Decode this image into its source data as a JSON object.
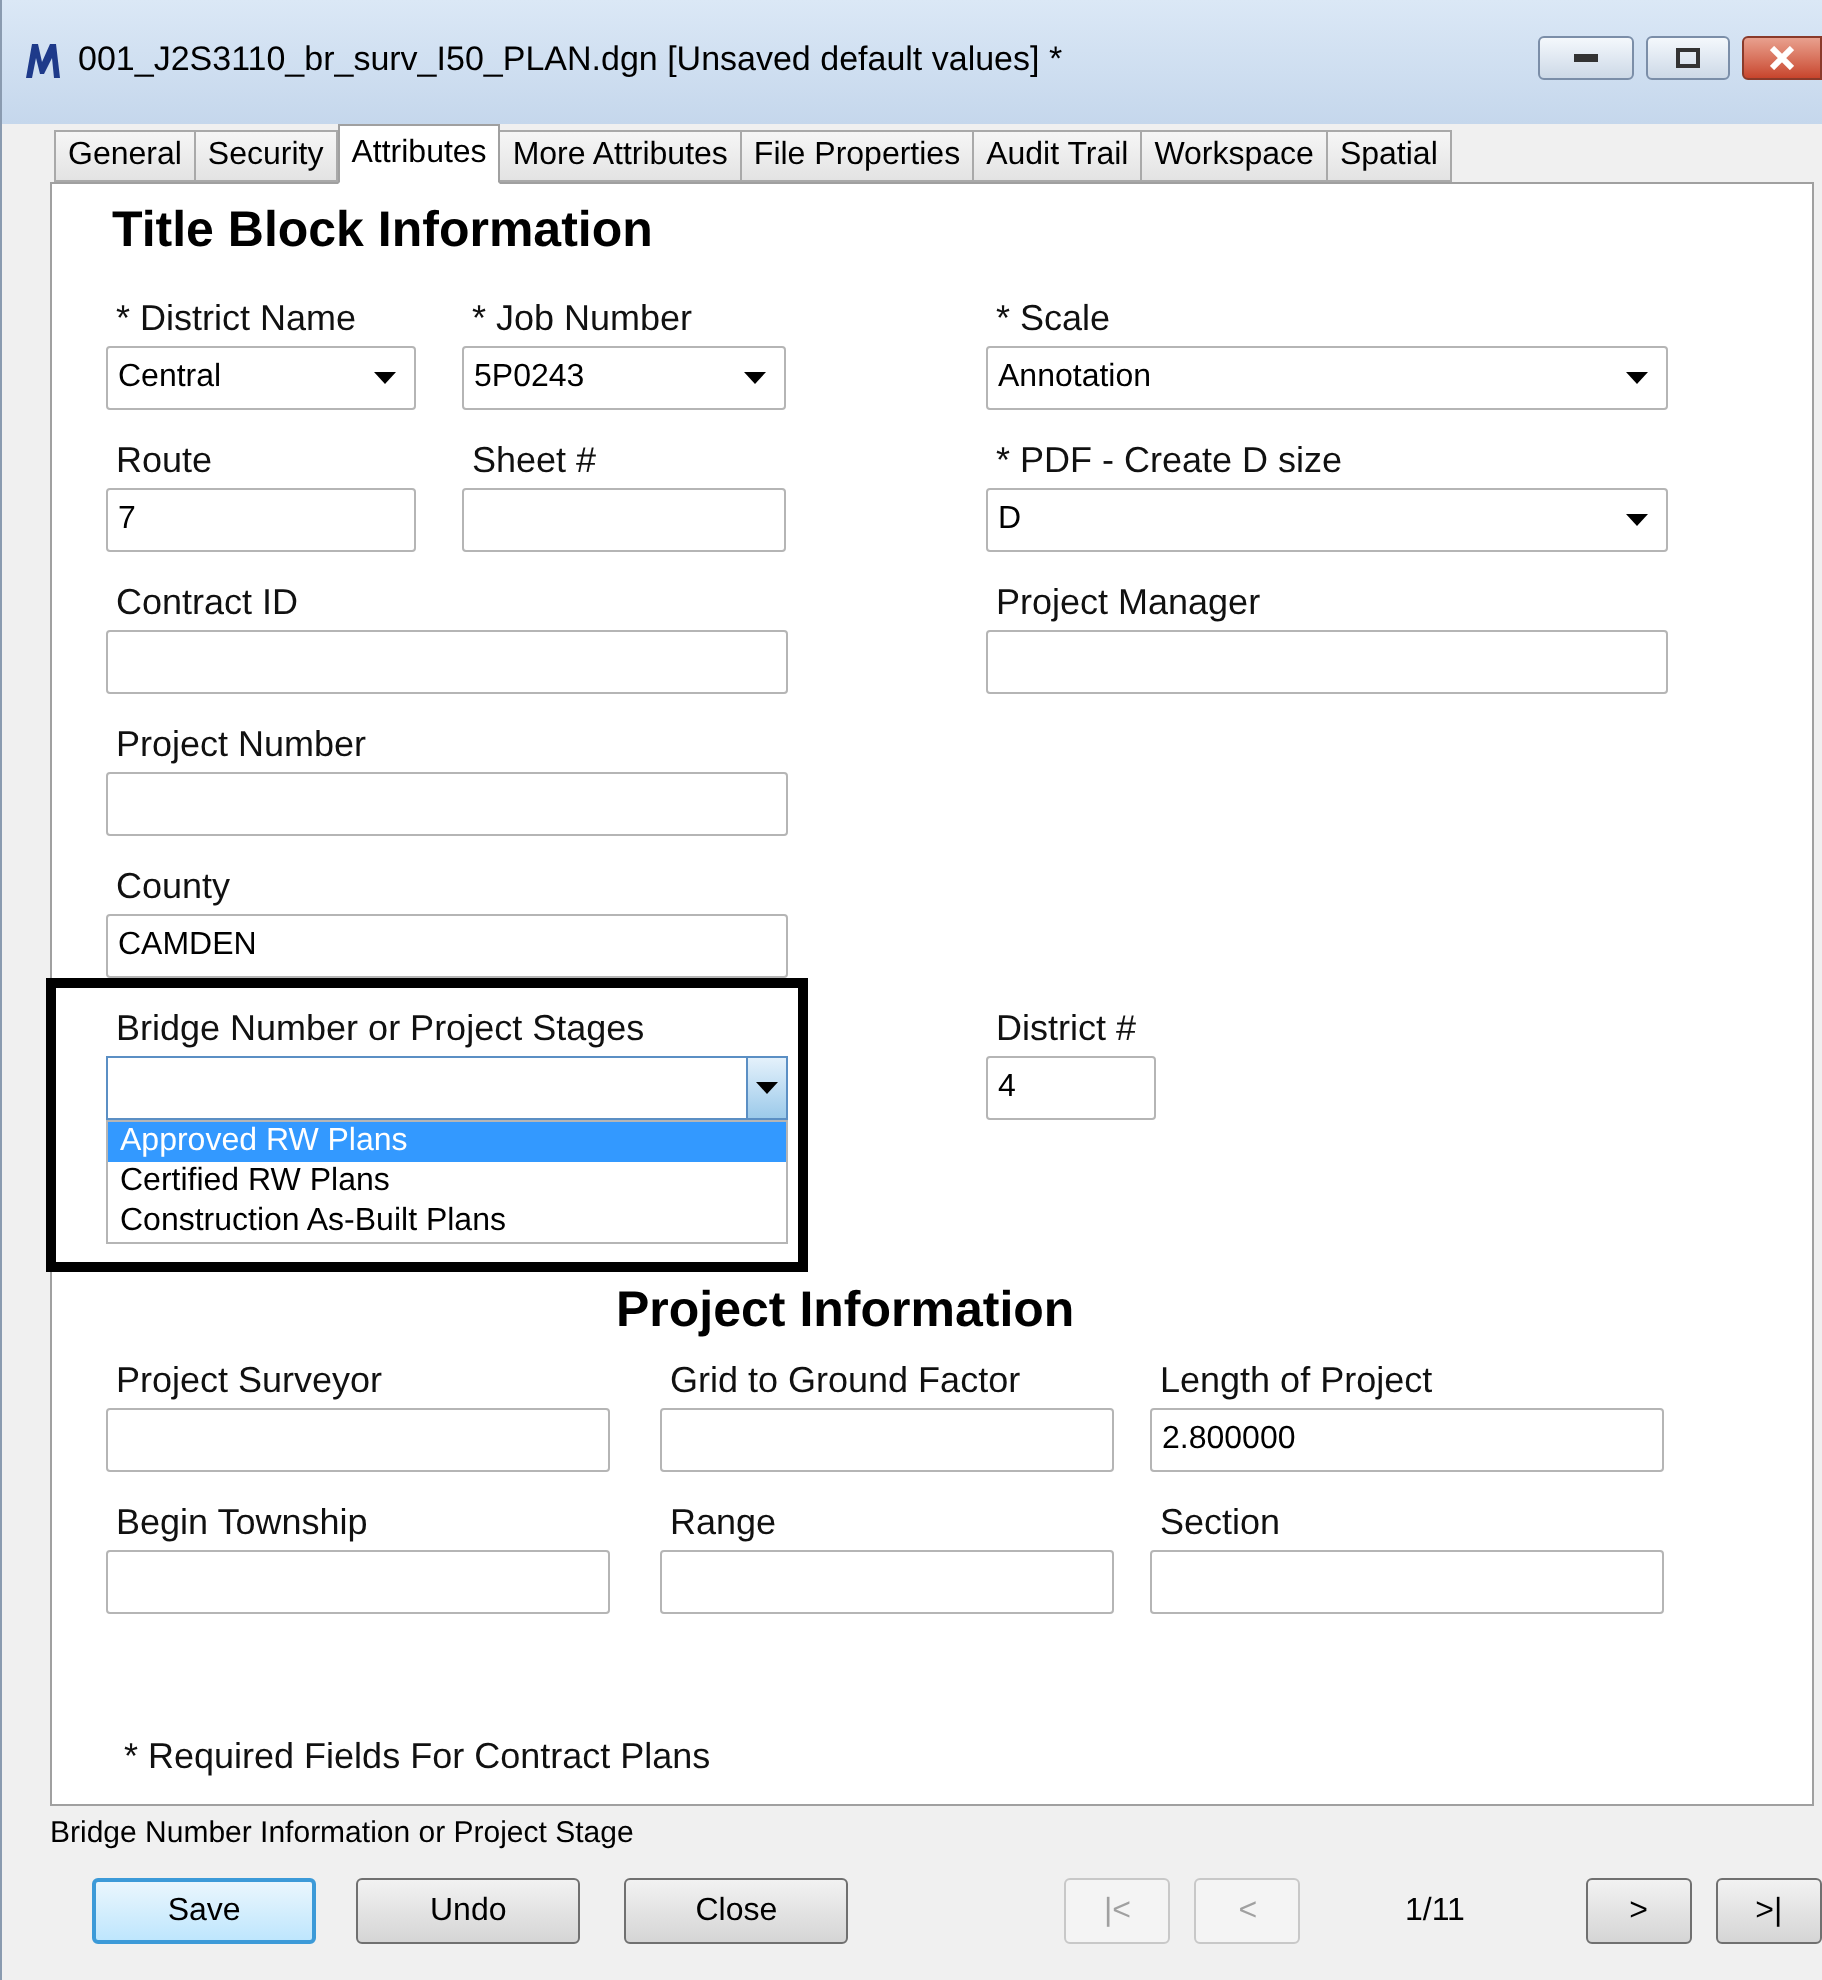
{
  "window": {
    "title": "001_J2S3110_br_surv_I50_PLAN.dgn [Unsaved default values] *"
  },
  "tabs": [
    {
      "label": "General",
      "selected": false
    },
    {
      "label": "Security",
      "selected": false
    },
    {
      "label": "Attributes",
      "selected": true
    },
    {
      "label": "More Attributes",
      "selected": false
    },
    {
      "label": "File Properties",
      "selected": false
    },
    {
      "label": "Audit Trail",
      "selected": false
    },
    {
      "label": "Workspace",
      "selected": false
    },
    {
      "label": "Spatial",
      "selected": false
    }
  ],
  "sections": [
    {
      "title": "Title Block Information",
      "rows": [
        [
          {
            "label": "* District Name",
            "kind": "dropdown",
            "value": "Central"
          },
          {
            "label": "* Job Number",
            "kind": "dropdown",
            "value": "5P0243"
          },
          {
            "label": "* Scale",
            "kind": "dropdown",
            "value": "Annotation"
          }
        ],
        [
          {
            "label": "Route",
            "kind": "text",
            "value": "7"
          },
          {
            "label": "Sheet #",
            "kind": "text"
          },
          {
            "label": "* PDF - Create D size",
            "kind": "dropdown",
            "value": "D"
          }
        ],
        [
          {
            "label": "Contract ID",
            "kind": "text"
          },
          {
            "label": "Project Manager",
            "kind": "text"
          }
        ],
        [
          {
            "label": "Project Number",
            "kind": "text"
          }
        ],
        [
          {
            "label": "County",
            "kind": "text",
            "value": "CAMDEN"
          }
        ],
        [
          {
            "label": "Bridge Number or Project Stages",
            "kind": "dropdown",
            "expanded": true,
            "highlighted": true,
            "options": [
              {
                "label": "Approved RW Plans",
                "selected": true
              },
              {
                "label": "Certified RW Plans",
                "selected": false
              },
              {
                "label": "Construction As-Built Plans",
                "selected": false
              }
            ]
          },
          {
            "label": "District #",
            "kind": "text",
            "value": "4"
          }
        ]
      ]
    },
    {
      "title": "Project Information",
      "rows": [
        [
          {
            "label": "Project Surveyor",
            "kind": "text"
          },
          {
            "label": "Grid to Ground Factor",
            "kind": "text"
          },
          {
            "label": "Length of Project",
            "kind": "text",
            "value": "2.800000"
          }
        ],
        [
          {
            "label": "Begin Township",
            "kind": "text"
          },
          {
            "label": "Range",
            "kind": "text"
          },
          {
            "label": "Section",
            "kind": "text"
          }
        ]
      ]
    }
  ],
  "footnote": "* Required Fields For Contract Plans",
  "status_bar": "Bridge Number Information or Project Stage",
  "buttons": [
    {
      "label": "Save",
      "focused": true
    },
    {
      "label": "Undo",
      "focused": false
    },
    {
      "label": "Close",
      "focused": false
    }
  ],
  "pager": {
    "first": {
      "label": "|<",
      "disabled": true
    },
    "previous": {
      "label": "<",
      "disabled": true
    },
    "position": "1/11",
    "next": {
      "label": ">",
      "disabled": false
    },
    "last": {
      "label": ">|",
      "disabled": false
    }
  }
}
